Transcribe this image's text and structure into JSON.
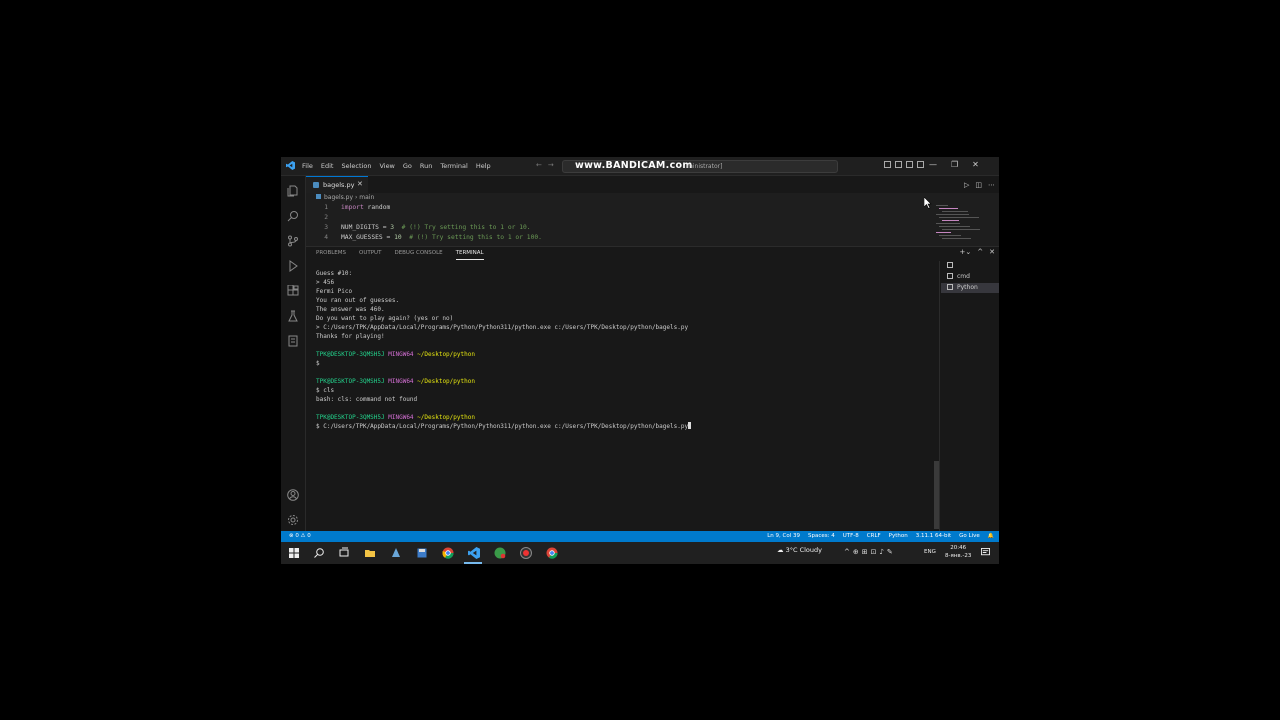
{
  "window": {
    "menu": [
      "File",
      "Edit",
      "Selection",
      "View",
      "Go",
      "Run",
      "Terminal",
      "Help"
    ],
    "watermark": "www.BANDICAM.com",
    "command_center_suffix": "ministrator]",
    "controls": [
      "—",
      "❐",
      "✕"
    ]
  },
  "editor": {
    "tab_label": "bagels.py",
    "breadcrumb": {
      "file": "bagels.py",
      "sep": "›",
      "symbol": "main"
    },
    "lines": [
      {
        "num": "1",
        "parts": [
          {
            "t": "import",
            "c": "kw"
          },
          {
            "t": " random",
            "c": ""
          }
        ]
      },
      {
        "num": "2",
        "parts": []
      },
      {
        "num": "3",
        "parts": [
          {
            "t": "NUM_DIGITS",
            "c": ""
          },
          {
            "t": " = ",
            "c": ""
          },
          {
            "t": "3",
            "c": "num"
          },
          {
            "t": "  # (!) Try setting this to 1 or 10.",
            "c": "cm"
          }
        ]
      },
      {
        "num": "4",
        "parts": [
          {
            "t": "MAX_GUESSES",
            "c": ""
          },
          {
            "t": " = ",
            "c": ""
          },
          {
            "t": "10",
            "c": "num"
          },
          {
            "t": "  # (!) Try setting this to 1 or 100.",
            "c": "cm"
          }
        ]
      }
    ]
  },
  "panel": {
    "tabs": [
      "PROBLEMS",
      "OUTPUT",
      "DEBUG CONSOLE",
      "TERMINAL"
    ],
    "terminal_list": [
      "cmd",
      "Python"
    ],
    "terminal_lines": [
      {
        "parts": [
          {
            "t": "Guess #10:",
            "c": ""
          }
        ]
      },
      {
        "parts": [
          {
            "t": "> 456",
            "c": ""
          }
        ]
      },
      {
        "parts": [
          {
            "t": "Fermi Pico",
            "c": ""
          }
        ]
      },
      {
        "parts": [
          {
            "t": "You ran out of guesses.",
            "c": ""
          }
        ]
      },
      {
        "parts": [
          {
            "t": "The answer was 460.",
            "c": ""
          }
        ]
      },
      {
        "parts": [
          {
            "t": "Do you want to play again? (yes or no)",
            "c": ""
          }
        ]
      },
      {
        "parts": [
          {
            "t": "> C:/Users/TPK/AppData/Local/Programs/Python/Python311/python.exe c:/Users/TPK/Desktop/python/bagels.py",
            "c": ""
          }
        ]
      },
      {
        "parts": [
          {
            "t": "Thanks for playing!",
            "c": ""
          }
        ]
      },
      {
        "parts": []
      },
      {
        "parts": [
          {
            "t": "TPK@DESKTOP-3QMSH5J",
            "c": "g"
          },
          {
            "t": " MINGW64",
            "c": "m"
          },
          {
            "t": " ~/Desktop/python",
            "c": "y"
          }
        ]
      },
      {
        "parts": [
          {
            "t": "$",
            "c": ""
          }
        ]
      },
      {
        "parts": []
      },
      {
        "parts": [
          {
            "t": "TPK@DESKTOP-3QMSH5J",
            "c": "g"
          },
          {
            "t": " MINGW64",
            "c": "m"
          },
          {
            "t": " ~/Desktop/python",
            "c": "y"
          }
        ]
      },
      {
        "parts": [
          {
            "t": "$ cls",
            "c": ""
          }
        ]
      },
      {
        "parts": [
          {
            "t": "bash: cls: command not found",
            "c": ""
          }
        ]
      },
      {
        "parts": []
      },
      {
        "parts": [
          {
            "t": "TPK@DESKTOP-3QMSH5J",
            "c": "g"
          },
          {
            "t": " MINGW64",
            "c": "m"
          },
          {
            "t": " ~/Desktop/python",
            "c": "y"
          }
        ]
      },
      {
        "parts": [
          {
            "t": "$ C:/Users/TPK/AppData/Local/Programs/Python/Python311/python.exe c:/Users/TPK/Desktop/python/bagels.py",
            "c": ""
          }
        ],
        "cursor": true
      }
    ]
  },
  "statusbar": {
    "left": "⊗ 0 ⚠ 0",
    "right": [
      "Ln 9, Col 39",
      "Spaces: 4",
      "UTF-8",
      "CRLF",
      "Python",
      "3.11.1 64-bit",
      "Go Live"
    ]
  },
  "taskbar": {
    "weather": "3°C  Cloudy",
    "lang": "ENG",
    "time": "20:46",
    "date": "8-янв.-23"
  },
  "colors": {
    "accent": "#007acc",
    "terminal_user": "#23d18b",
    "terminal_host": "#d670d6",
    "terminal_path": "#e5e510"
  }
}
